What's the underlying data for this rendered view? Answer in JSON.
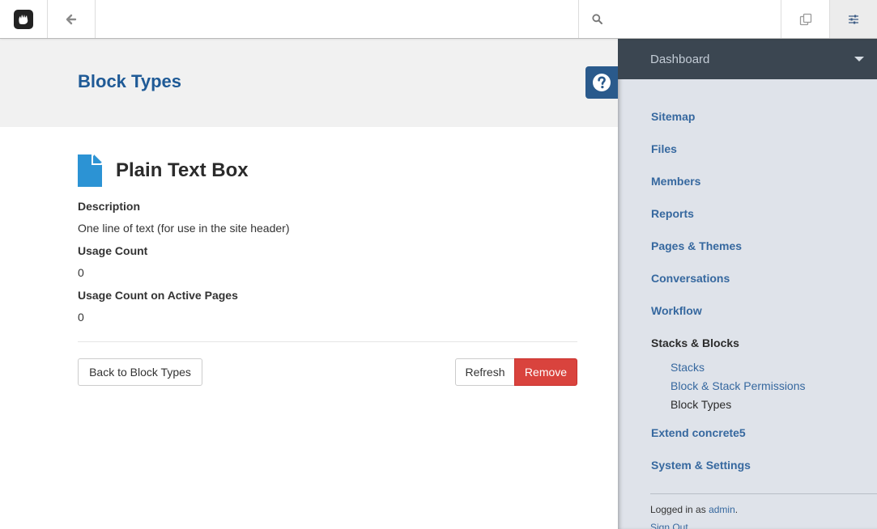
{
  "toolbar": {
    "search_placeholder": "",
    "icons": [
      "concrete5-logo-icon",
      "back-arrow-icon",
      "search-icon",
      "page-list-icon",
      "dashboard-sliders-icon"
    ]
  },
  "header": {
    "title": "Block Types",
    "help_icon": "question-circle-icon"
  },
  "block": {
    "name": "Plain Text Box",
    "icon": "document-icon",
    "fields": [
      {
        "label": "Description",
        "value": "One line of text (for use in the site header)"
      },
      {
        "label": "Usage Count",
        "value": "0"
      },
      {
        "label": "Usage Count on Active Pages",
        "value": "0"
      }
    ]
  },
  "actions": {
    "back_label": "Back to Block Types",
    "refresh_label": "Refresh",
    "remove_label": "Remove"
  },
  "panel": {
    "title": "Dashboard",
    "items": [
      {
        "label": "Sitemap"
      },
      {
        "label": "Files"
      },
      {
        "label": "Members"
      },
      {
        "label": "Reports"
      },
      {
        "label": "Pages & Themes"
      },
      {
        "label": "Conversations"
      },
      {
        "label": "Workflow"
      },
      {
        "label": "Stacks & Blocks"
      },
      {
        "label": "Extend concrete5"
      },
      {
        "label": "System & Settings"
      }
    ],
    "subitems": [
      {
        "label": "Stacks"
      },
      {
        "label": "Block & Stack Permissions"
      },
      {
        "label": "Block Types"
      }
    ],
    "logged_in_prefix": "Logged in as",
    "user": "admin",
    "sign_out": "Sign Out"
  },
  "colors": {
    "accent": "#1f5a96",
    "danger": "#d9433d",
    "panel_bg": "#dfe3ea",
    "panel_head": "#3b4651",
    "link": "#36689f"
  }
}
